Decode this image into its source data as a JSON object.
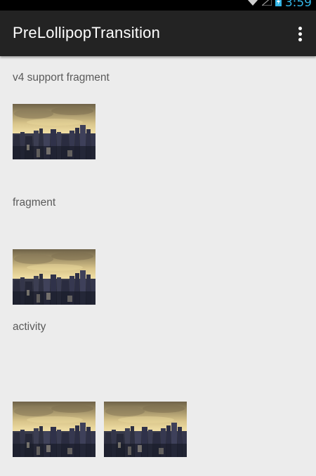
{
  "status_bar": {
    "time": "3:59",
    "icons": [
      "wifi-icon",
      "signal-icon",
      "battery-icon"
    ],
    "time_color": "#33b5e5"
  },
  "action_bar": {
    "title": "PreLollipopTransition",
    "overflow_icon": "overflow-menu-icon"
  },
  "sections": [
    {
      "label": "v4 support fragment",
      "images": [
        "city-skyline-image"
      ]
    },
    {
      "label": "fragment",
      "images": [
        "city-skyline-image"
      ]
    },
    {
      "label": "activity",
      "images": [
        "city-skyline-image",
        "city-skyline-image"
      ]
    }
  ]
}
